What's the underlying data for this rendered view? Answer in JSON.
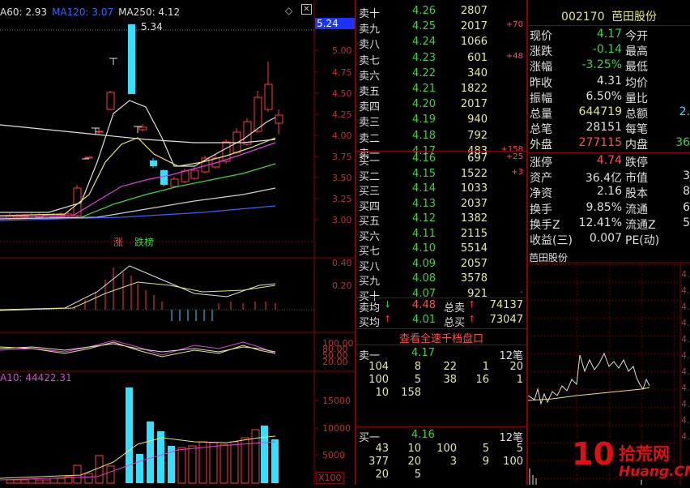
{
  "main_chart": {
    "ma_legend": [
      {
        "label": "A60: 2.93",
        "color": "#e0e0e0"
      },
      {
        "label": "MA120: 3.07",
        "color": "#3366ff"
      },
      {
        "label": "MA250: 4.12",
        "color": "#e0e0e0"
      }
    ],
    "peak_label": "5.34",
    "current_price_tag": "5.24",
    "price_axis": [
      "5.00",
      "4.75",
      "4.50",
      "4.25",
      "4.00",
      "3.75",
      "3.50",
      "3.25",
      "3.00"
    ],
    "badge_zhang": "涨",
    "badge_dieban": "跌榜",
    "macd_axis": [
      "0.40",
      "0.20"
    ],
    "kdj_axis": [
      "100.00",
      "80.00",
      "50.00",
      "20.00"
    ],
    "vol_legend": "A10: 44422.31",
    "vol_axis": [
      "15000",
      "10000",
      "5000"
    ],
    "vol_unit": "X100"
  },
  "order_book": {
    "asks": [
      {
        "label": "卖十",
        "price": "4.26",
        "vol": "2807",
        "chg": ""
      },
      {
        "label": "卖九",
        "price": "4.25",
        "vol": "2017",
        "chg": "+70"
      },
      {
        "label": "卖八",
        "price": "4.24",
        "vol": "1066",
        "chg": ""
      },
      {
        "label": "卖七",
        "price": "4.23",
        "vol": "601",
        "chg": "+48"
      },
      {
        "label": "卖六",
        "price": "4.22",
        "vol": "340",
        "chg": ""
      },
      {
        "label": "卖五",
        "price": "4.21",
        "vol": "1822",
        "chg": ""
      },
      {
        "label": "卖四",
        "price": "4.20",
        "vol": "2017",
        "chg": ""
      },
      {
        "label": "卖三",
        "price": "4.19",
        "vol": "940",
        "chg": ""
      },
      {
        "label": "卖二",
        "price": "4.18",
        "vol": "792",
        "chg": ""
      },
      {
        "label": "卖一",
        "price": "4.17",
        "vol": "483",
        "chg": "+158"
      }
    ],
    "bids": [
      {
        "label": "买一",
        "price": "4.16",
        "vol": "697",
        "chg": "+25"
      },
      {
        "label": "买二",
        "price": "4.15",
        "vol": "1522",
        "chg": "+3"
      },
      {
        "label": "买三",
        "price": "4.14",
        "vol": "1033",
        "chg": ""
      },
      {
        "label": "买四",
        "price": "4.13",
        "vol": "2037",
        "chg": ""
      },
      {
        "label": "买五",
        "price": "4.12",
        "vol": "1382",
        "chg": ""
      },
      {
        "label": "买六",
        "price": "4.11",
        "vol": "2115",
        "chg": ""
      },
      {
        "label": "买七",
        "price": "4.10",
        "vol": "5514",
        "chg": ""
      },
      {
        "label": "买八",
        "price": "4.09",
        "vol": "2057",
        "chg": ""
      },
      {
        "label": "买九",
        "price": "4.08",
        "vol": "3578",
        "chg": ""
      },
      {
        "label": "买十",
        "price": "4.07",
        "vol": "921",
        "chg": "-"
      }
    ],
    "avg_sell": {
      "label": "卖均",
      "price": "4.48",
      "total_label": "总卖",
      "total": "74137"
    },
    "avg_buy": {
      "label": "买均",
      "price": "4.01",
      "total_label": "总买",
      "total": "73047"
    },
    "link": "查看全速千档盘口",
    "sell1": {
      "label": "卖一",
      "price": "4.17",
      "count": "12笔",
      "rows": [
        [
          "104",
          "8",
          "22",
          "1",
          "20"
        ],
        [
          "100",
          "5",
          "38",
          "16",
          "1"
        ],
        [
          "10",
          "158",
          "",
          "",
          ""
        ]
      ]
    },
    "buy1": {
      "label": "买一",
      "price": "4.16",
      "count": "12笔",
      "rows": [
        [
          "43",
          "10",
          "100",
          "5",
          "5"
        ],
        [
          "377",
          "20",
          "3",
          "9",
          "100"
        ],
        [
          "20",
          "5",
          "",
          "",
          ""
        ]
      ]
    }
  },
  "quote": {
    "code": "002170",
    "name": "芭田股份",
    "rows": [
      {
        "k1": "现价",
        "v1": "4.17",
        "c1": "dn",
        "k2": "今开",
        "v2": "",
        "c2": "wt"
      },
      {
        "k1": "涨跌",
        "v1": "-0.14",
        "c1": "dn",
        "k2": "最高",
        "v2": "",
        "c2": "wt"
      },
      {
        "k1": "涨幅",
        "v1": "-3.25%",
        "c1": "dn",
        "k2": "最低",
        "v2": "",
        "c2": "wt"
      },
      {
        "k1": "昨收",
        "v1": "4.31",
        "c1": "wt",
        "k2": "均价",
        "v2": "",
        "c2": "wt"
      },
      {
        "k1": "振幅",
        "v1": "6.50%",
        "c1": "wt",
        "k2": "量比",
        "v2": "",
        "c2": "wt"
      },
      {
        "k1": "总量",
        "v1": "644719",
        "c1": "yl",
        "k2": "总额",
        "v2": "2.",
        "c2": "cy"
      },
      {
        "k1": "总笔",
        "v1": "28151",
        "c1": "wt",
        "k2": "每笔",
        "v2": "",
        "c2": "wt"
      },
      {
        "k1": "外盘",
        "v1": "277115",
        "c1": "up",
        "k2": "内盘",
        "v2": "36",
        "c2": "dn"
      }
    ],
    "rows2": [
      {
        "k1": "涨停",
        "v1": "4.74",
        "c1": "up",
        "k2": "跌停",
        "v2": "",
        "c2": "wt"
      },
      {
        "k1": "资产",
        "v1": "36.4亿",
        "c1": "wt",
        "k2": "市值",
        "v2": "3",
        "c2": "wt"
      },
      {
        "k1": "净资",
        "v1": "2.16",
        "c1": "wt",
        "k2": "股本",
        "v2": "8",
        "c2": "wt"
      },
      {
        "k1": "换手",
        "v1": "9.85%",
        "c1": "wt",
        "k2": "流通",
        "v2": "6",
        "c2": "wt"
      },
      {
        "k1": "换手Z",
        "v1": "12.41%",
        "c1": "wt",
        "k2": "流通Z",
        "v2": "5",
        "c2": "wt"
      },
      {
        "k1": "收益(三)",
        "v1": "0.007",
        "c1": "wt",
        "k2": "PE(动)",
        "v2": "",
        "c2": "wt"
      }
    ]
  },
  "mini_chart": {
    "title": "芭田股份",
    "axis": [
      "4.5",
      "4.",
      "4.",
      "4.",
      "4.",
      "4.",
      "4.",
      "4.",
      "4.",
      "4.",
      "4."
    ]
  },
  "watermark": {
    "brand": "拾荒网",
    "num": "10",
    "url": "Huang.CN"
  },
  "colors": {
    "up": "#ff3c3c",
    "down": "#33e0ff",
    "border": "#8a0000"
  }
}
